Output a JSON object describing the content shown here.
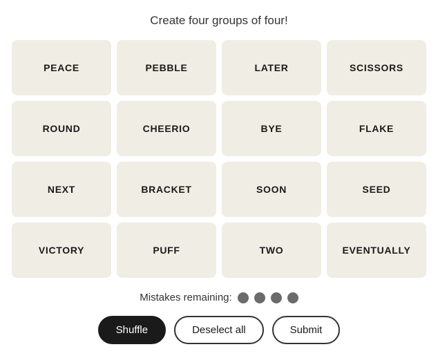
{
  "instruction": "Create four groups of four!",
  "tiles": [
    {
      "label": "PEACE"
    },
    {
      "label": "PEBBLE"
    },
    {
      "label": "LATER"
    },
    {
      "label": "SCISSORS"
    },
    {
      "label": "ROUND"
    },
    {
      "label": "CHEERIO"
    },
    {
      "label": "BYE"
    },
    {
      "label": "FLAKE"
    },
    {
      "label": "NEXT"
    },
    {
      "label": "BRACKET"
    },
    {
      "label": "SOON"
    },
    {
      "label": "SEED"
    },
    {
      "label": "VICTORY"
    },
    {
      "label": "PUFF"
    },
    {
      "label": "TWO"
    },
    {
      "label": "EVENTUALLY"
    }
  ],
  "mistakes": {
    "label": "Mistakes remaining:",
    "count": 4
  },
  "buttons": {
    "shuffle": "Shuffle",
    "deselect": "Deselect all",
    "submit": "Submit"
  }
}
